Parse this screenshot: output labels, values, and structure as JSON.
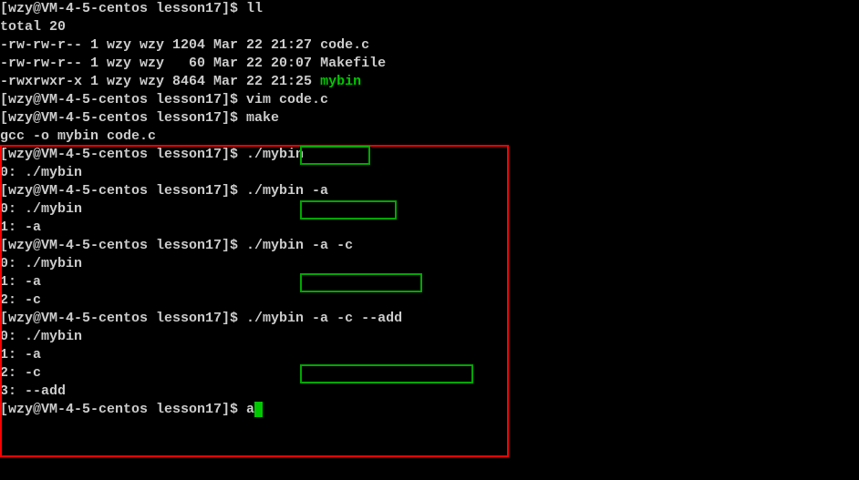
{
  "prompt_prefix": "[wzy@VM-4-5-centos lesson17]$ ",
  "commands": {
    "ll": "ll",
    "vim": "vim code.c",
    "make": "make",
    "run1": "./mybin",
    "run2": "./mybin -a",
    "run3": "./mybin -a -c",
    "run4": "./mybin -a -c --add",
    "last": "a"
  },
  "ll_output": {
    "total": "total 20",
    "rows": [
      {
        "perm": "-rw-rw-r-- 1 wzy wzy 1204 Mar 22 21:27 ",
        "name": "code.c",
        "cls": "white"
      },
      {
        "perm": "-rw-rw-r-- 1 wzy wzy   60 Mar 22 20:07 ",
        "name": "Makefile",
        "cls": "white"
      },
      {
        "perm": "-rwxrwxr-x 1 wzy wzy 8464 Mar 22 21:25 ",
        "name": "mybin",
        "cls": "green"
      }
    ]
  },
  "make_output": "gcc -o mybin code.c",
  "run_outputs": {
    "r1": [
      "0: ./mybin"
    ],
    "r2": [
      "0: ./mybin",
      "1: -a"
    ],
    "r3": [
      "0: ./mybin",
      "1: -a",
      "2: -c"
    ],
    "r4": [
      "0: ./mybin",
      "1: -a",
      "2: -c",
      "3: --add"
    ]
  }
}
